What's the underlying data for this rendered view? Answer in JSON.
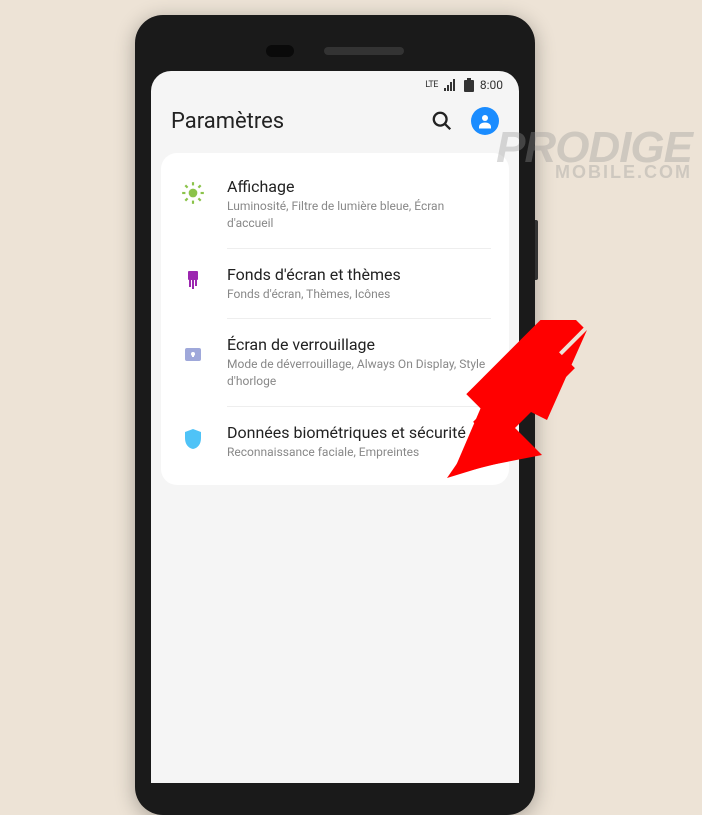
{
  "statusbar": {
    "network": "LTE",
    "time": "8:00"
  },
  "header": {
    "title": "Paramètres"
  },
  "items": [
    {
      "title": "Affichage",
      "subtitle": "Luminosité, Filtre de lumière bleue, Écran d'accueil",
      "icon": "brightness",
      "color": "#8bc34a"
    },
    {
      "title": "Fonds d'écran et thèmes",
      "subtitle": "Fonds d'écran, Thèmes, Icônes",
      "icon": "brush",
      "color": "#9c27b0"
    },
    {
      "title": "Écran de verrouillage",
      "subtitle": "Mode de déverrouillage, Always On Display, Style d'horloge",
      "icon": "lock",
      "color": "#7986cb"
    },
    {
      "title": "Données biométriques et sécurité",
      "subtitle": "Reconnaissance faciale, Empreintes",
      "icon": "shield",
      "color": "#4fc3f7"
    }
  ],
  "watermark": {
    "line1": "PRODIGE",
    "line2": "MOBILE.COM"
  }
}
